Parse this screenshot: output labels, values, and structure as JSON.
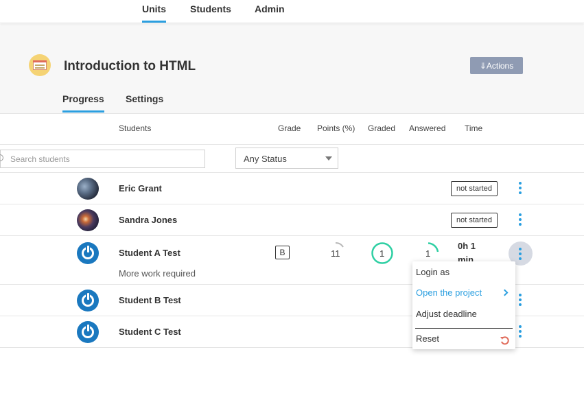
{
  "topnav": {
    "tabs": [
      {
        "label": "Units",
        "active": true
      },
      {
        "label": "Students",
        "active": false
      },
      {
        "label": "Admin",
        "active": false
      }
    ]
  },
  "header": {
    "title": "Introduction to HTML",
    "actions_label": "⇓Actions",
    "subtabs": [
      {
        "label": "Progress",
        "active": true
      },
      {
        "label": "Settings",
        "active": false
      }
    ]
  },
  "table": {
    "columns": {
      "students": "Students",
      "grade": "Grade",
      "points": "Points (%)",
      "graded": "Graded",
      "answered": "Answered",
      "time": "Time"
    },
    "search": {
      "placeholder": "Search students",
      "value": ""
    },
    "status_filter": {
      "selected": "Any Status"
    },
    "rows": [
      {
        "name": "Eric Grant",
        "status": "not started",
        "avatar": "photo-avatar"
      },
      {
        "name": "Sandra Jones",
        "status": "not started",
        "avatar": "photo-avatar"
      },
      {
        "name": "Student A Test",
        "avatar": "power-icon",
        "grade": "B",
        "points": "11",
        "graded": "1",
        "answered": "1",
        "time_line1": "0h 1",
        "time_line2": "min",
        "note": "More work required"
      },
      {
        "name": "Student B Test",
        "avatar": "power-icon"
      },
      {
        "name": "Student C Test",
        "avatar": "power-icon"
      }
    ]
  },
  "context_menu": {
    "items": [
      {
        "label": "Login as"
      },
      {
        "label": "Open the project"
      },
      {
        "label": "Adjust deadline"
      },
      {
        "label": "Reset"
      }
    ]
  },
  "colors": {
    "accent": "#2b9fe0",
    "actions_button": "#8f9bb3",
    "graded_ring": "#2ecfa3",
    "reset_icon": "#e06b5a",
    "avatar_blue": "#1a78bf"
  }
}
